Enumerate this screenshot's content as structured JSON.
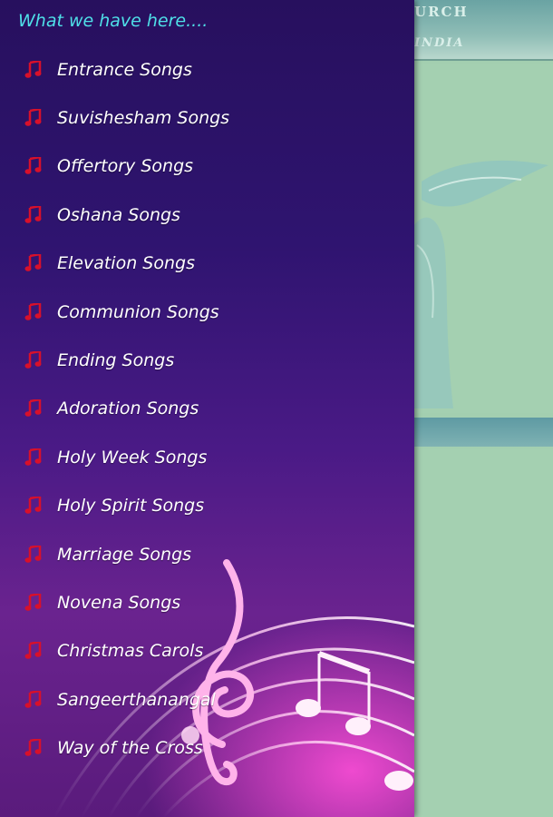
{
  "background": {
    "banner_line1": "URCH",
    "banner_line2": "INDIA"
  },
  "drawer": {
    "header": "What we have here....",
    "icon": "music-note-icon",
    "icon_color": "#d8102a",
    "items": [
      {
        "label": "Entrance Songs"
      },
      {
        "label": "Suvishesham Songs"
      },
      {
        "label": "Offertory Songs"
      },
      {
        "label": "Oshana Songs"
      },
      {
        "label": "Elevation Songs"
      },
      {
        "label": "Communion Songs"
      },
      {
        "label": "Ending Songs"
      },
      {
        "label": "Adoration Songs"
      },
      {
        "label": "Holy Week Songs"
      },
      {
        "label": "Holy Spirit Songs"
      },
      {
        "label": "Marriage Songs"
      },
      {
        "label": "Novena Songs"
      },
      {
        "label": "Christmas Carols"
      },
      {
        "label": "Sangeerthanangal"
      },
      {
        "label": "Way of the Cross"
      }
    ]
  }
}
